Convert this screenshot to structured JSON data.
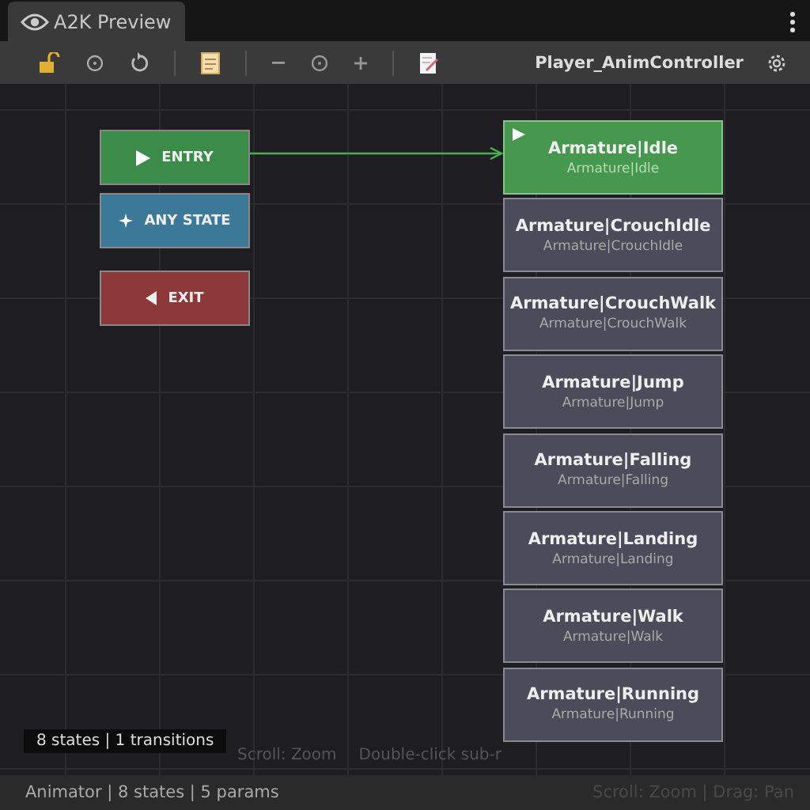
{
  "tab": {
    "title": "A2K Preview",
    "selected": true
  },
  "toolbar": {
    "controller": "Player_AnimController"
  },
  "special_nodes": [
    {
      "kind": "entry",
      "label": "ENTRY"
    },
    {
      "kind": "any",
      "label": "ANY STATE"
    },
    {
      "kind": "exit",
      "label": "EXIT"
    }
  ],
  "states": [
    {
      "name": "Armature|Idle",
      "clip": "Armature|Idle",
      "default": true
    },
    {
      "name": "Armature|CrouchIdle",
      "clip": "Armature|CrouchIdle",
      "default": false
    },
    {
      "name": "Armature|CrouchWalk",
      "clip": "Armature|CrouchWalk",
      "default": false
    },
    {
      "name": "Armature|Jump",
      "clip": "Armature|Jump",
      "default": false
    },
    {
      "name": "Armature|Falling",
      "clip": "Armature|Falling",
      "default": false
    },
    {
      "name": "Armature|Landing",
      "clip": "Armature|Landing",
      "default": false
    },
    {
      "name": "Armature|Walk",
      "clip": "Armature|Walk",
      "default": false
    },
    {
      "name": "Armature|Running",
      "clip": "Armature|Running",
      "default": false
    }
  ],
  "hints": [
    "Scroll: Zoom",
    "Double-click sub-r"
  ],
  "badge": "8 states | 1 transitions",
  "status_bar": {
    "left": "Animator | 8 states | 5 params",
    "right": "Scroll: Zoom | Drag: Pan"
  }
}
